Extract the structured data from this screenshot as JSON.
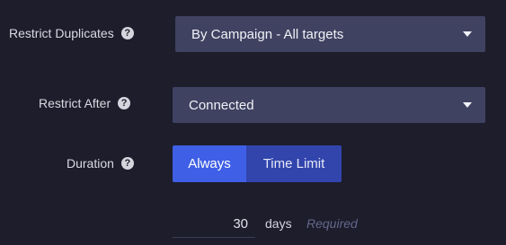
{
  "restrict_duplicates": {
    "label": "Restrict Duplicates",
    "help_icon": "?",
    "selected": "By Campaign - All targets"
  },
  "restrict_after": {
    "label": "Restrict After",
    "help_icon": "?",
    "selected": "Connected"
  },
  "duration": {
    "label": "Duration",
    "help_icon": "?",
    "options": [
      "Always",
      "Time Limit"
    ],
    "active_option": "Always"
  },
  "duration_value": {
    "value": "30",
    "unit": "days",
    "hint": "Required"
  },
  "colors": {
    "background": "#1d1d2c",
    "select_bg": "#3f4261",
    "active_button": "#3e5fe6",
    "inactive_button": "#3245ad",
    "hint_text": "#63678a"
  },
  "icons": {
    "help": "question-circle-icon",
    "dropdown": "caret-down-icon"
  }
}
